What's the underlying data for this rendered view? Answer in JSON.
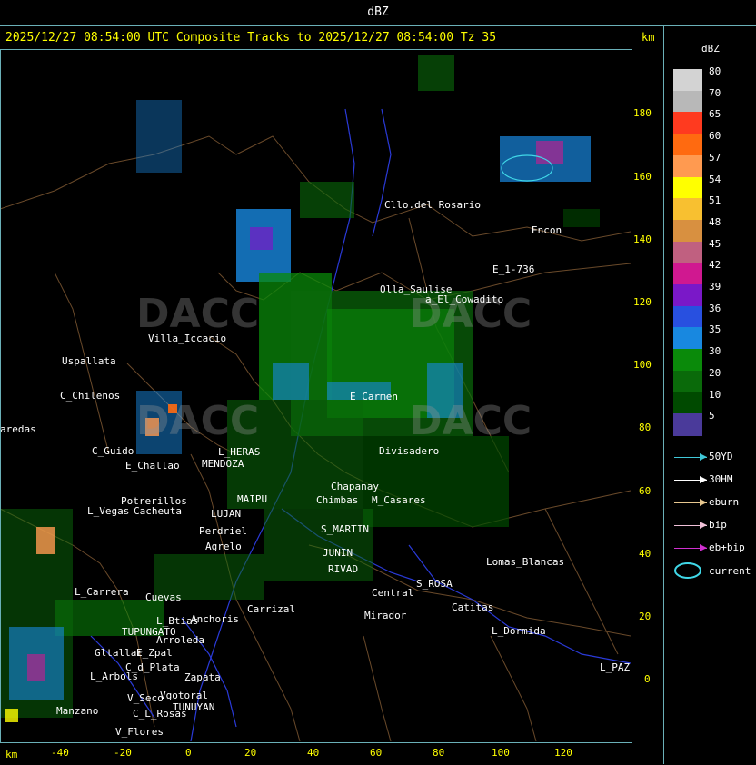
{
  "window": {
    "title": "dBZ"
  },
  "header": {
    "line": "2025/12/27 08:54:00 UTC Composite Tracks to 2025/12/27 08:54:00 Tz 35",
    "km_label": "km",
    "km_label_bottom": "km"
  },
  "axes": {
    "y_ticks": [
      "180",
      "160",
      "140",
      "120",
      "100",
      "80",
      "60",
      "40",
      "20",
      "0"
    ],
    "x_ticks": [
      "-40",
      "-20",
      "0",
      "20",
      "40",
      "60",
      "80",
      "100",
      "120"
    ]
  },
  "legend": {
    "title": "dBZ",
    "levels": [
      {
        "value": "80",
        "color": "#d3d3d3"
      },
      {
        "value": "70",
        "color": "#b8b8b8"
      },
      {
        "value": "65",
        "color": "#ff3a1f"
      },
      {
        "value": "60",
        "color": "#ff6a10"
      },
      {
        "value": "57",
        "color": "#ff9a50"
      },
      {
        "value": "54",
        "color": "#ffff00"
      },
      {
        "value": "51",
        "color": "#f8c030"
      },
      {
        "value": "48",
        "color": "#d89040"
      },
      {
        "value": "45",
        "color": "#c06080"
      },
      {
        "value": "42",
        "color": "#d01890"
      },
      {
        "value": "39",
        "color": "#7a18c8"
      },
      {
        "value": "36",
        "color": "#2850e0"
      },
      {
        "value": "35",
        "color": "#1888e0"
      },
      {
        "value": "30",
        "color": "#0a8a0a"
      },
      {
        "value": "20",
        "color": "#0a6a0a"
      },
      {
        "value": "10",
        "color": "#004a00"
      },
      {
        "value": "5",
        "color": "#4a3a9a"
      }
    ],
    "tracks": [
      {
        "label": "50YD",
        "color": "#40c8d8"
      },
      {
        "label": "30HM",
        "color": "#ffffff"
      },
      {
        "label": "eburn",
        "color": "#e8c890"
      },
      {
        "label": "bip",
        "color": "#f0c0d8"
      },
      {
        "label": "eb+bip",
        "color": "#d030d0"
      }
    ],
    "current_label": "current",
    "current_color": "#40d8e8"
  },
  "places": [
    {
      "name": "Cllo.del Rosario"
    },
    {
      "name": "Encon"
    },
    {
      "name": "E_1-736"
    },
    {
      "name": "Olla_Saulise"
    },
    {
      "name": "a_El_Cowadito"
    },
    {
      "name": "Villa_Iccacio"
    },
    {
      "name": "Uspallata"
    },
    {
      "name": "C_Chilenos"
    },
    {
      "name": "aredas"
    },
    {
      "name": "C_Guido"
    },
    {
      "name": "L_HERAS"
    },
    {
      "name": "E_Challao"
    },
    {
      "name": "MENDOZA"
    },
    {
      "name": "Potrerillos"
    },
    {
      "name": "L_Vegas"
    },
    {
      "name": "Cacheuta"
    },
    {
      "name": "MAIPU"
    },
    {
      "name": "LUJAN"
    },
    {
      "name": "Perdriel"
    },
    {
      "name": "Agrelo"
    },
    {
      "name": "S_MARTIN"
    },
    {
      "name": "JUNIN"
    },
    {
      "name": "RIVAD"
    },
    {
      "name": "Chapanay"
    },
    {
      "name": "Chimbas"
    },
    {
      "name": "M_Casares"
    },
    {
      "name": "E_Carmen"
    },
    {
      "name": "Divisadero"
    },
    {
      "name": "S_ROSA"
    },
    {
      "name": "Lomas_Blancas"
    },
    {
      "name": "Catitas"
    },
    {
      "name": "L_Dormida"
    },
    {
      "name": "L_PAZ"
    },
    {
      "name": "Central"
    },
    {
      "name": "Mirador"
    },
    {
      "name": "L_Carrera"
    },
    {
      "name": "Cuevas"
    },
    {
      "name": "TUPUNGATO"
    },
    {
      "name": "Arroleda"
    },
    {
      "name": "Anchoris"
    },
    {
      "name": "Carrizal"
    },
    {
      "name": "L_Btias"
    },
    {
      "name": "Gltallar"
    },
    {
      "name": "E_Zpal"
    },
    {
      "name": "L_Arbols"
    },
    {
      "name": "C_d_Plata"
    },
    {
      "name": "Zapata"
    },
    {
      "name": "Manzano"
    },
    {
      "name": "TUNUYAN"
    },
    {
      "name": "C_L_Rosas"
    },
    {
      "name": "V_Flores"
    },
    {
      "name": "Vgotoral"
    },
    {
      "name": "V_Seco"
    }
  ],
  "watermark": {
    "text": "DACC"
  }
}
